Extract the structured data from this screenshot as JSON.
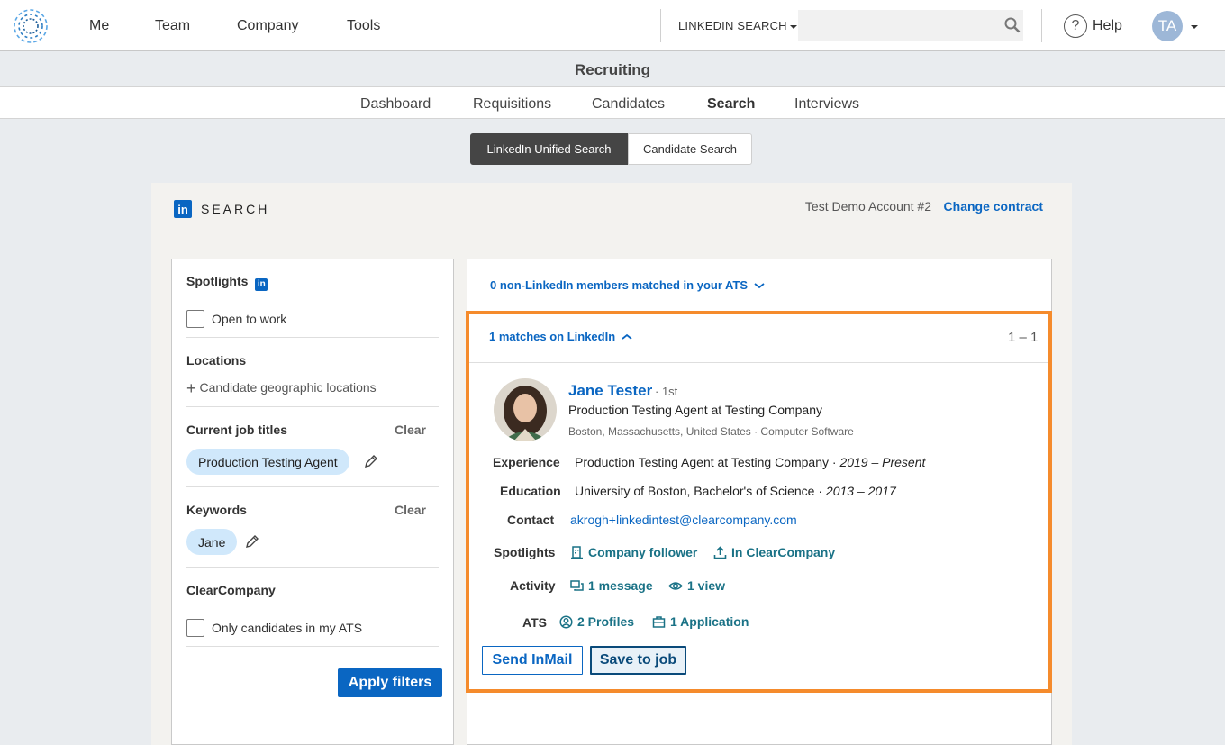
{
  "nav": {
    "items": [
      "Me",
      "Team",
      "Company",
      "Tools"
    ],
    "search_mode": "LINKEDIN SEARCH",
    "search_value": "",
    "help": "Help",
    "avatar_initials": "TA"
  },
  "section": {
    "title": "Recruiting",
    "tabs": [
      "Dashboard",
      "Requisitions",
      "Candidates",
      "Search",
      "Interviews"
    ],
    "active_tab": "Search"
  },
  "search_toggle": {
    "options": [
      "LinkedIn Unified Search",
      "Candidate Search"
    ],
    "active": "LinkedIn Unified Search"
  },
  "panel": {
    "logo_text": "in",
    "title": "SEARCH",
    "account": "Test Demo Account #2",
    "change_contract": "Change contract"
  },
  "filters": {
    "spotlights": {
      "heading": "Spotlights",
      "option": "Open to work",
      "checked": false
    },
    "locations": {
      "heading": "Locations",
      "add": "Candidate geographic locations"
    },
    "job_titles": {
      "heading": "Current job titles",
      "clear": "Clear",
      "pill": "Production Testing Agent"
    },
    "keywords": {
      "heading": "Keywords",
      "clear": "Clear",
      "pill": "Jane"
    },
    "clearcompany": {
      "heading": "ClearCompany",
      "option": "Only candidates in my ATS",
      "checked": false
    },
    "apply": "Apply filters"
  },
  "results": {
    "ats_toggle": "0 non-LinkedIn members matched in your ATS",
    "matches": "1 matches on LinkedIn",
    "range": "1 – 1",
    "candidate": {
      "name": "Jane Tester",
      "degree": "· 1st",
      "headline": "Production Testing Agent at Testing Company",
      "meta": "Boston, Massachusetts, United States · Computer Software",
      "experience_label": "Experience",
      "experience": "Production Testing Agent at Testing Company · ",
      "experience_dates": "2019 – Present",
      "education_label": "Education",
      "education": "University of Boston, Bachelor's of Science · ",
      "education_dates": "2013 – 2017",
      "contact_label": "Contact",
      "contact": "akrogh+linkedintest@clearcompany.com",
      "spotlights_label": "Spotlights",
      "spotlight_1": "Company follower",
      "spotlight_2": "In ClearCompany",
      "activity_label": "Activity",
      "activity_1": "1 message",
      "activity_2": "1 view",
      "ats_label": "ATS",
      "ats_1": "2 Profiles",
      "ats_2": "1 Application"
    },
    "send_inmail": "Send InMail",
    "save_to_job": "Save to job"
  },
  "colors": {
    "linkedin_blue": "#0a66c2",
    "highlight_orange": "#f58b2c",
    "teal_link": "#1a7286",
    "pill_bg": "#d0e8fb"
  }
}
